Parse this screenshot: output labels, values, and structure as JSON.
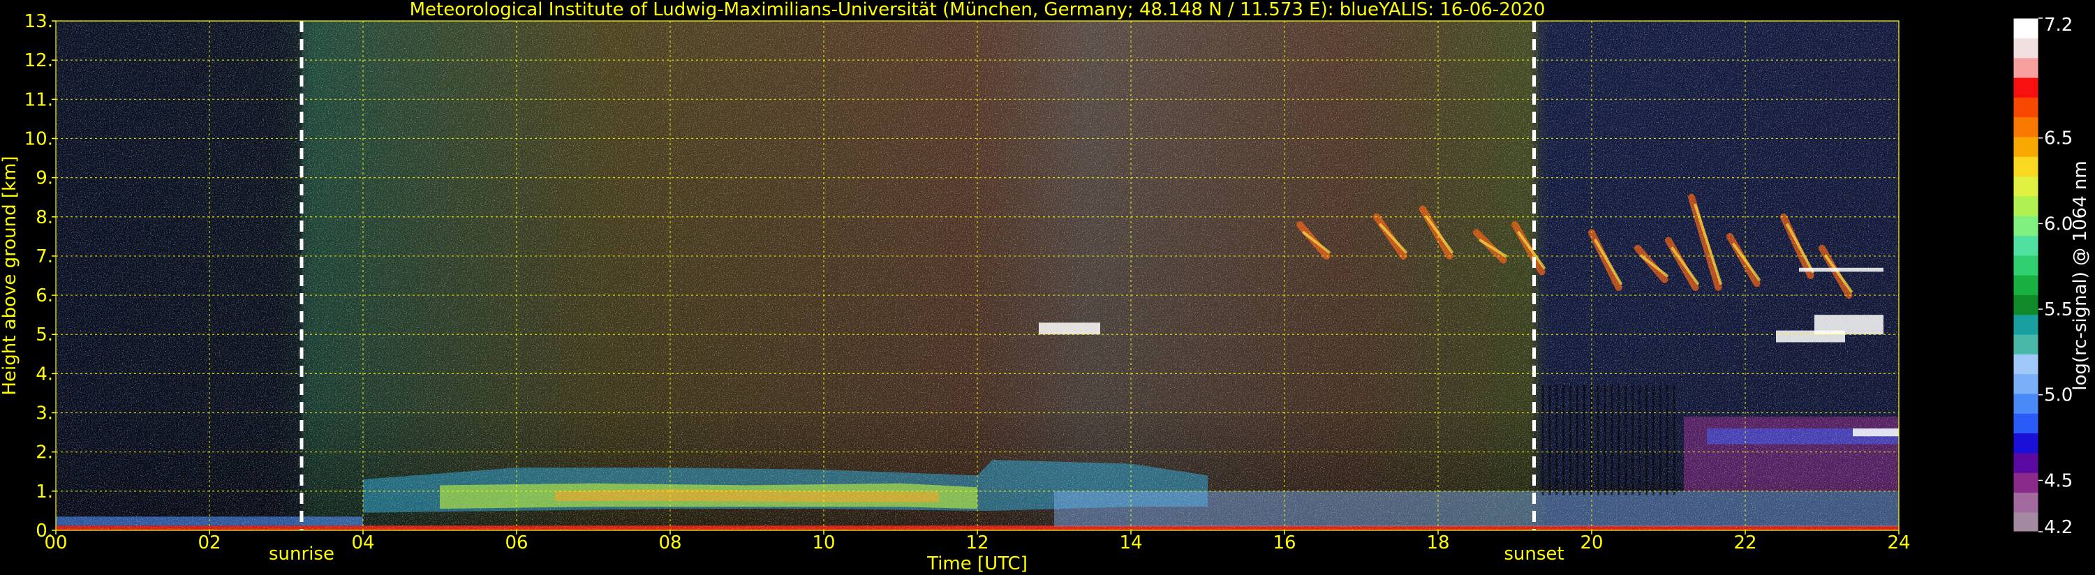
{
  "chart_data": {
    "type": "heatmap",
    "title": "Meteorological Institute of Ludwig-Maximilians-Universität (München, Germany; 48.148 N / 11.573 E):     blueYALIS: 16-06-2020",
    "xlabel": "Time [UTC]",
    "ylabel": "Height above ground [km]",
    "xlim": [
      0,
      24
    ],
    "ylim": [
      0,
      13
    ],
    "x_ticks": [
      "00",
      "02",
      "04",
      "06",
      "08",
      "10",
      "12",
      "14",
      "16",
      "18",
      "20",
      "22",
      "24"
    ],
    "y_ticks": [
      "0.",
      "1.",
      "2.",
      "3.",
      "4.",
      "5.",
      "6.",
      "7.",
      "8.",
      "9.",
      "10.",
      "11.",
      "12.",
      "13."
    ],
    "grid": true,
    "markers": [
      {
        "label": "sunrise",
        "x": 3.2
      },
      {
        "label": "sunset",
        "x": 19.25
      }
    ],
    "colorbar": {
      "label": "log(rc-signal) @ 1064 nm",
      "min": 4.2,
      "max": 7.2,
      "ticks": [
        "7.2",
        "6.5",
        "6.0",
        "5.5",
        "5.0",
        "4.5",
        "4.2"
      ],
      "tick_values": [
        7.2,
        6.5,
        6.0,
        5.5,
        5.0,
        4.5,
        4.2
      ],
      "colors_bottom_to_top": [
        "#a48aa0",
        "#a36aa0",
        "#8a2a8a",
        "#5a0aa0",
        "#1a10d8",
        "#2a5af8",
        "#4a8af8",
        "#7ab0f8",
        "#a0c8f8",
        "#4ab8a8",
        "#18a0a0",
        "#108a28",
        "#18b040",
        "#30d070",
        "#50e0a0",
        "#80f080",
        "#b0f050",
        "#e0f040",
        "#f8d820",
        "#f8a800",
        "#f87800",
        "#f84800",
        "#f81010",
        "#f8a0a0",
        "#f0e0e0",
        "#ffffff"
      ]
    }
  },
  "colors": {
    "background": "#000000",
    "text": "#ffff00",
    "grid": "#ffff00",
    "colorbar_text": "#ffffff"
  }
}
